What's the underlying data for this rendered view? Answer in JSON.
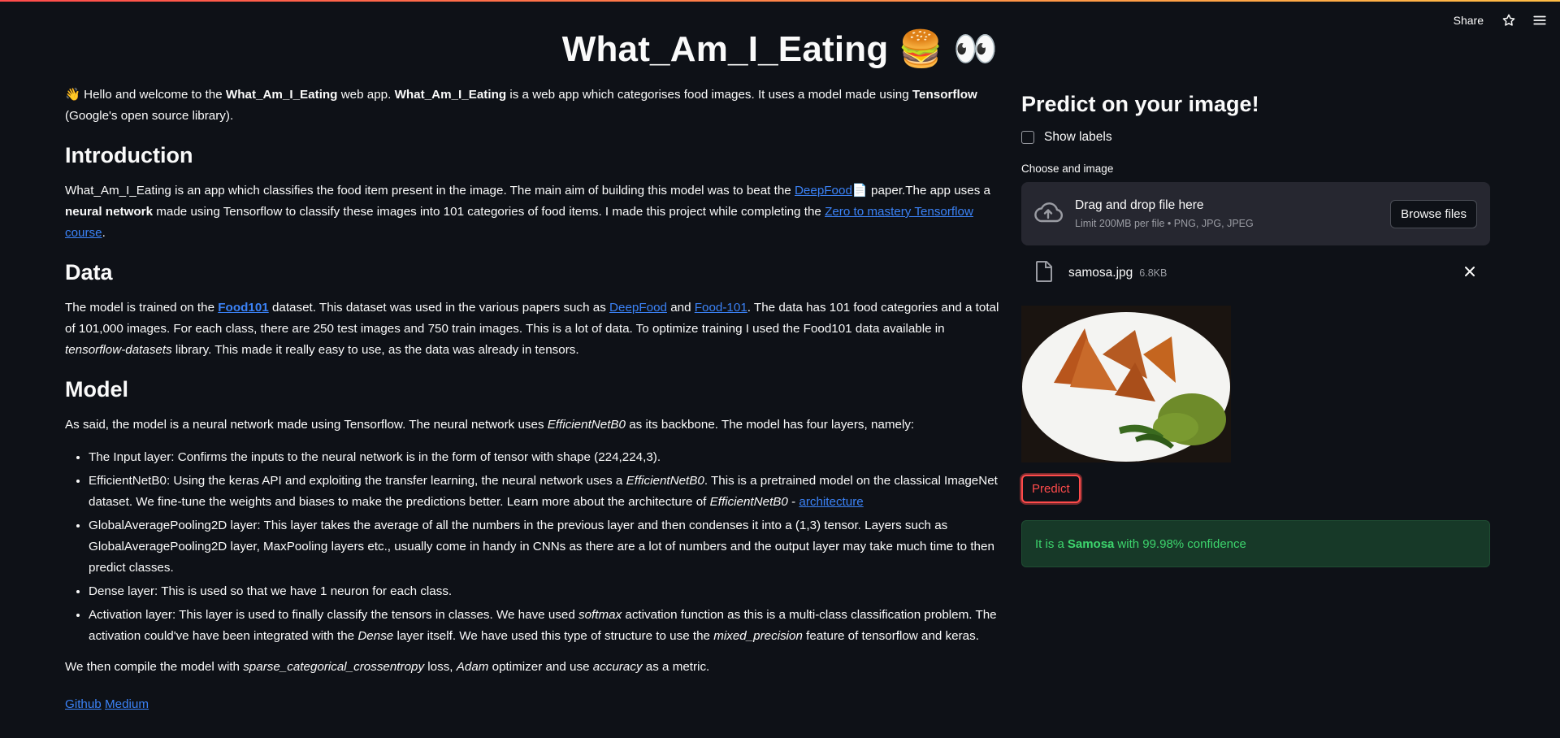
{
  "toolbar": {
    "share_label": "Share",
    "star_icon": "star-icon",
    "menu_icon": "hamburger-menu-icon"
  },
  "title": "What_Am_I_Eating 🍔 👀",
  "intro": {
    "wave": "👋",
    "t1": " Hello and welcome to the ",
    "b1": "What_Am_I_Eating",
    "t2": " web app. ",
    "b2": "What_Am_I_Eating",
    "t3": " is a web app which categorises food images. It uses a model made using ",
    "b3": "Tensorflow",
    "t4": " (Google's open source library)."
  },
  "introduction": {
    "heading": "Introduction",
    "t1": "What_Am_I_Eating is an app which classifies the food item present in the image. The main aim of building this model was to beat the ",
    "link1": "DeepFood",
    "t2": "📄 paper.The app uses a ",
    "b1": "neural network",
    "t3": " made using Tensorflow to classify these images into 101 categories of food items. I made this project while completing the ",
    "link2": "Zero to mastery Tensorflow course",
    "t4": "."
  },
  "data_section": {
    "heading": "Data",
    "t1": "The model is trained on the ",
    "link1": "Food101",
    "t2": " dataset. This dataset was used in the various papers such as ",
    "link2": "DeepFood",
    "t3": " and ",
    "link3": "Food-101",
    "t4": ". The data has 101 food categories and a total of 101,000 images. For each class, there are 250 test images and 750 train images. This is a lot of data. To optimize training I used the Food101 data available in ",
    "i1": "tensorflow-datasets",
    "t5": " library. This made it really easy to use, as the data was already in tensors."
  },
  "model": {
    "heading": "Model",
    "p1a": "As said, the model is a neural network made using Tensorflow. The neural network uses ",
    "p1i": "EfficientNetB0",
    "p1b": " as its backbone. The model has four layers, namely:",
    "li1": "The Input layer: Confirms the inputs to the neural network is in the form of tensor with shape (224,224,3).",
    "li2a": "EfficientNetB0: Using the keras API and exploiting the transfer learning, the neural network uses a ",
    "li2i": "EfficientNetB0",
    "li2b": ". This is a pretrained model on the classical ImageNet dataset. We fine-tune the weights and biases to make the predictions better. Learn more about the architecture of ",
    "li2i2": "EfficientNetB0",
    "li2c": " - ",
    "li2link": "architecture",
    "li3": "GlobalAveragePooling2D layer: This layer takes the average of all the numbers in the previous layer and then condenses it into a (1,3) tensor. Layers such as GlobalAveragePooling2D layer, MaxPooling layers etc., usually come in handy in CNNs as there are a lot of numbers and the output layer may take much time to then predict classes.",
    "li4": "Dense layer: This is used so that we have 1 neuron for each class.",
    "li5a": "Activation layer: This layer is used to finally classify the tensors in classes. We have used ",
    "li5i1": "softmax",
    "li5b": " activation function as this is a multi-class classification problem. The activation could've have been integrated with the ",
    "li5i2": "Dense",
    "li5c": " layer itself. We have used this type of structure to use the ",
    "li5i3": "mixed_precision",
    "li5d": " feature of tensorflow and keras.",
    "p2a": "We then compile the model with ",
    "p2i1": "sparse_categorical_crossentropy",
    "p2b": " loss, ",
    "p2i2": "Adam",
    "p2c": " optimizer and use ",
    "p2i3": "accuracy",
    "p2d": " as a metric."
  },
  "footer_links": {
    "github": "Github",
    "medium": "Medium"
  },
  "sidebar": {
    "heading": "Predict on your image!",
    "show_labels": "Show labels",
    "upload_label": "Choose and image",
    "drop_title": "Drag and drop file here",
    "drop_sub": "Limit 200MB per file • PNG, JPG, JPEG",
    "browse": "Browse files",
    "file_name": "samosa.jpg",
    "file_size": "6.8KB",
    "predict": "Predict",
    "result_pre": "It is a ",
    "result_food": "Samosa",
    "result_post": " with 99.98% confidence"
  },
  "colors": {
    "background": "#0e1117",
    "accent": "#ff4b4b",
    "link": "#3b82f6",
    "success_text": "#3dd56d",
    "success_bg": "#173928"
  }
}
